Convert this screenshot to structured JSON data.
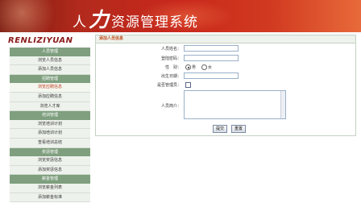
{
  "header": {
    "title_prefix": "人",
    "title_big": "力",
    "title_suffix": "资源管理系统"
  },
  "logo": "RENLIZIYUAN",
  "menu": [
    {
      "type": "group",
      "label": "人员管理"
    },
    {
      "type": "item",
      "label": "浏览人员信息"
    },
    {
      "type": "item",
      "label": "添加人员信息"
    },
    {
      "type": "group",
      "label": "招聘管理"
    },
    {
      "type": "item",
      "label": "浏览应聘信息",
      "active": true
    },
    {
      "type": "item",
      "label": "添加应聘信息"
    },
    {
      "type": "item",
      "label": "浏览人才库"
    },
    {
      "type": "group",
      "label": "培训管理"
    },
    {
      "type": "item",
      "label": "浏览培训计划"
    },
    {
      "type": "item",
      "label": "添加培训计划"
    },
    {
      "type": "item",
      "label": "查看培训总结"
    },
    {
      "type": "group",
      "label": "奖惩管理"
    },
    {
      "type": "item",
      "label": "浏览奖惩信息"
    },
    {
      "type": "item",
      "label": "添加奖惩信息"
    },
    {
      "type": "group",
      "label": "薪金管理"
    },
    {
      "type": "item",
      "label": "浏览薪金列表"
    },
    {
      "type": "item",
      "label": "添加薪金标准"
    }
  ],
  "form": {
    "heading": "添加人员信息",
    "name_label": "人员姓名：",
    "password_label": "登陆密码：",
    "gender_label": "性　别：",
    "gender_male": "男",
    "gender_female": "女",
    "birth_label": "出生日期：",
    "admin_label": "是否管理员：",
    "intro_label": "人员简介：",
    "submit_label": "提交",
    "reset_label": "重置"
  }
}
